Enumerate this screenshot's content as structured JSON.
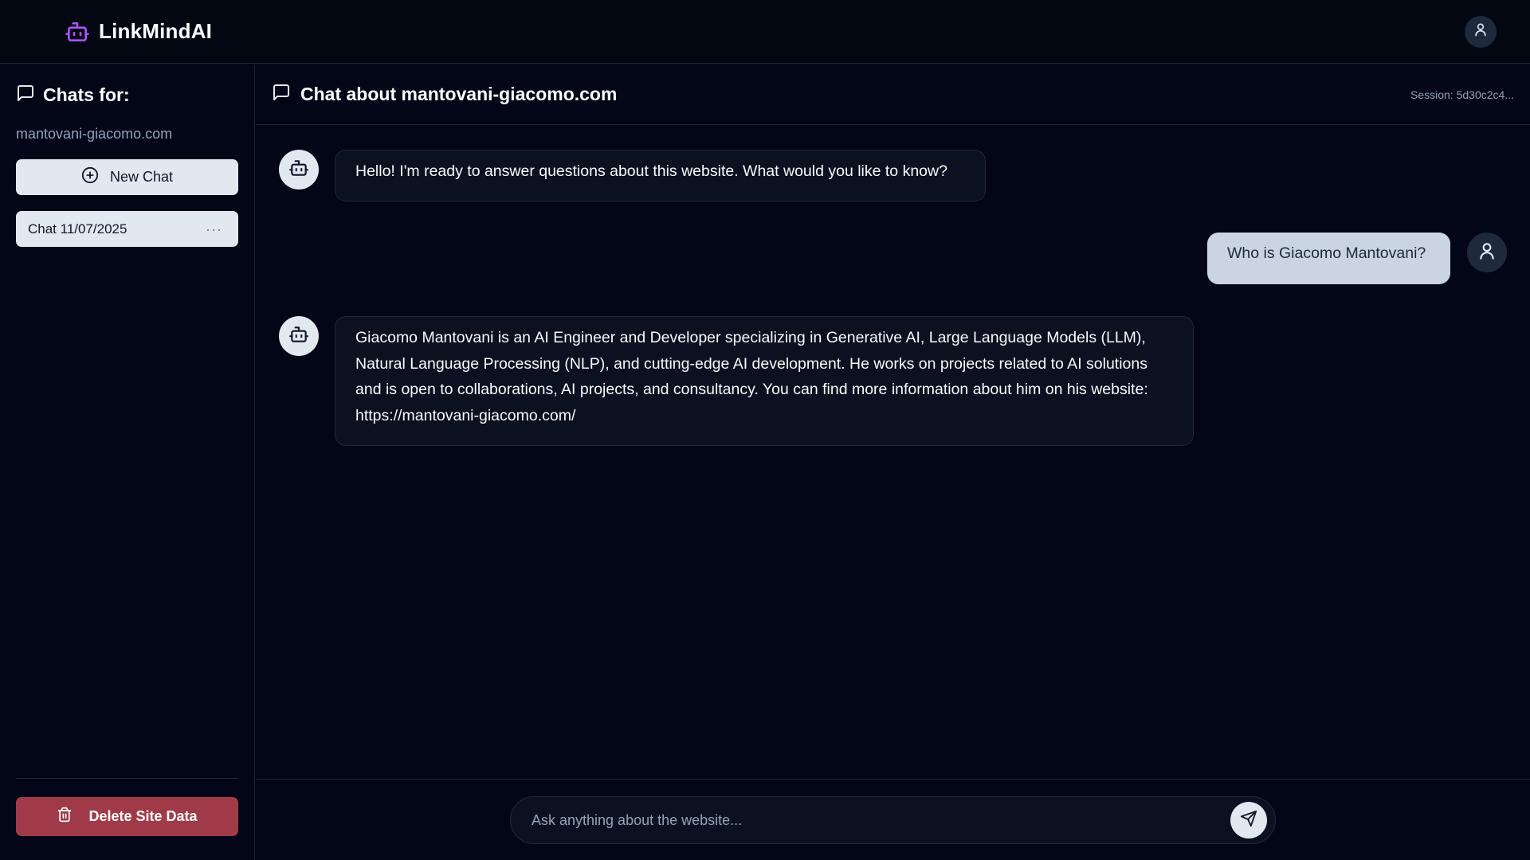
{
  "app": {
    "brand_name": "LinkMindAI",
    "brand_icon": "bot-icon",
    "accent_color": "#a855f7"
  },
  "sidebar": {
    "title": "Chats for:",
    "site": "mantovani-giacomo.com",
    "new_chat_label": "New Chat",
    "chats": [
      {
        "label": "Chat 11/07/2025",
        "menu": "···"
      }
    ],
    "delete_label": "Delete Site Data",
    "delete_color": "#9f3b48"
  },
  "main": {
    "title": "Chat about mantovani-giacomo.com",
    "session": "Session: 5d30c2c4...",
    "messages": [
      {
        "role": "bot",
        "text": "Hello! I'm ready to answer questions about this website. What would you like to know?"
      },
      {
        "role": "user",
        "text": "Who is Giacomo Mantovani?"
      },
      {
        "role": "bot",
        "text": "Giacomo Mantovani is an AI Engineer and Developer specializing in Generative AI, Large Language Models (LLM), Natural Language Processing (NLP), and cutting-edge AI development. He works on projects related to AI solutions and is open to collaborations, AI projects, and consultancy. You can find more information about him on his website: https://mantovani-giacomo.com/"
      }
    ],
    "input_placeholder": "Ask anything about the website..."
  }
}
